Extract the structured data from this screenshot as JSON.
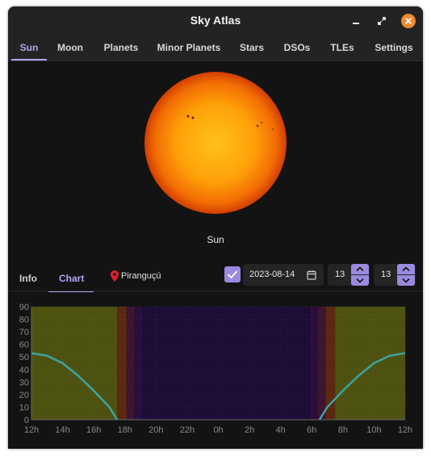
{
  "window": {
    "title": "Sky Atlas"
  },
  "tabs": [
    {
      "label": "Sun",
      "active": true
    },
    {
      "label": "Moon"
    },
    {
      "label": "Planets"
    },
    {
      "label": "Minor Planets"
    },
    {
      "label": "Stars"
    },
    {
      "label": "DSOs"
    },
    {
      "label": "TLEs"
    },
    {
      "label": "Settings"
    }
  ],
  "sun": {
    "label": "Sun"
  },
  "subtabs": [
    {
      "label": "Info"
    },
    {
      "label": "Chart",
      "active": true
    }
  ],
  "location": {
    "name": "Piranguçú"
  },
  "controls": {
    "date": "2023-08-14",
    "hour": "13",
    "minute": "13",
    "checkbox_checked": true
  },
  "colors": {
    "accent": "#9a89de",
    "day_band": "#4e5210",
    "night_band": "#1e0d37",
    "twilight_band": "#5c2910",
    "altitude_line": "#3ba4a4"
  },
  "chart_data": {
    "type": "line",
    "title": "",
    "xlabel": "",
    "ylabel": "",
    "ylim": [
      0,
      90
    ],
    "yticks": [
      0,
      10,
      20,
      30,
      40,
      50,
      60,
      70,
      80,
      90
    ],
    "xticks": [
      "12h",
      "14h",
      "16h",
      "18h",
      "20h",
      "22h",
      "0h",
      "2h",
      "4h",
      "6h",
      "8h",
      "10h",
      "12h"
    ],
    "xlim_hours": [
      12,
      36
    ],
    "grid": true,
    "series": [
      {
        "x": [
          12,
          13,
          14,
          15,
          16,
          17,
          17.5,
          30.5,
          31,
          32,
          33,
          34,
          35,
          36
        ],
        "y": [
          53,
          51,
          45,
          35,
          23,
          10,
          0,
          0,
          10,
          23,
          35,
          45,
          51,
          53
        ]
      }
    ],
    "bands": [
      {
        "from": 12,
        "to": 17.5,
        "kind": "day"
      },
      {
        "from": 17.5,
        "to": 18.1,
        "kind": "civil"
      },
      {
        "from": 18.1,
        "to": 18.6,
        "kind": "nautical"
      },
      {
        "from": 18.6,
        "to": 19.1,
        "kind": "astronomical"
      },
      {
        "from": 19.1,
        "to": 29.9,
        "kind": "night"
      },
      {
        "from": 29.9,
        "to": 30.4,
        "kind": "astronomical"
      },
      {
        "from": 30.4,
        "to": 30.9,
        "kind": "nautical"
      },
      {
        "from": 30.9,
        "to": 31.5,
        "kind": "civil"
      },
      {
        "from": 31.5,
        "to": 36,
        "kind": "day"
      }
    ]
  }
}
